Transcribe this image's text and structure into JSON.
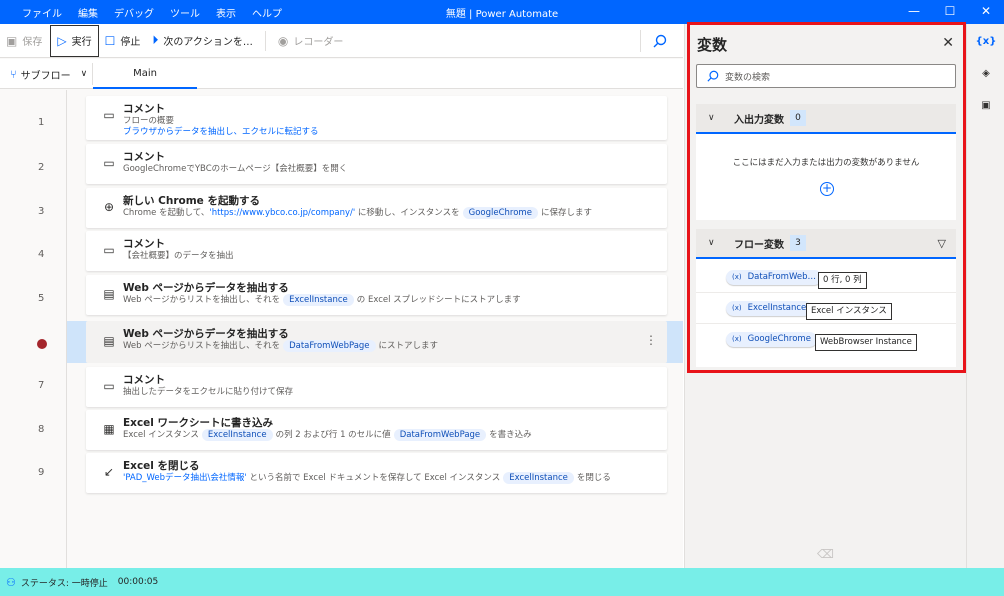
{
  "titlebar": {
    "menu": [
      "ファイル",
      "編集",
      "デバッグ",
      "ツール",
      "表示",
      "ヘルプ"
    ],
    "title": "無題 | Power Automate",
    "minimize": "—",
    "maximize": "☐",
    "close": "✕"
  },
  "toolbar": {
    "save": "保存",
    "run": "実行",
    "stop": "停止",
    "next": "次のアクションを…",
    "recorder": "レコーダー"
  },
  "tabs": {
    "subflow": "サブフロー",
    "main": "Main"
  },
  "steps": [
    {
      "line": "1",
      "title": "コメント",
      "desc": "フローの概要",
      "desc2": "ブラウザからデータを抽出し、エクセルに転記する"
    },
    {
      "line": "2",
      "title": "コメント",
      "desc": "GoogleChromeでYBCのホームページ【会社概要】を開く"
    },
    {
      "line": "3",
      "title": "新しい Chrome を起動する",
      "desc_a": "Chrome を起動して、",
      "desc_url": "'https://www.ybco.co.jp/company/'",
      "desc_b": " に移動し、インスタンスを",
      "desc_var": "GoogleChrome",
      "desc_c": "に保存します"
    },
    {
      "line": "4",
      "title": "コメント",
      "desc": "【会社概要】のデータを抽出"
    },
    {
      "line": "5",
      "title": "Web ページからデータを抽出する",
      "desc_a": "Web ページからリストを抽出し、それを",
      "desc_var": "ExcelInstance",
      "desc_b": "の Excel スプレッドシートにストアします"
    },
    {
      "line": "6",
      "title": "Web ページからデータを抽出する",
      "desc_a": "Web ページからリストを抽出し、それを",
      "desc_var": "DataFromWebPage",
      "desc_b": "にストアします"
    },
    {
      "line": "7",
      "title": "コメント",
      "desc": "抽出したデータをエクセルに貼り付けて保存"
    },
    {
      "line": "8",
      "title": "Excel ワークシートに書き込み",
      "desc_a": "Excel インスタンス",
      "desc_var": "ExcelInstance",
      "desc_b": "の列 2 および行 1 のセルに値",
      "desc_var2": "DataFromWebPage",
      "desc_c": "を書き込み"
    },
    {
      "line": "9",
      "title": "Excel を閉じる",
      "desc_url": "'PAD_Webデータ抽出\\会社情報'",
      "desc_a": " という名前で Excel ドキュメントを保存して Excel インスタンス",
      "desc_var": "ExcelInstance",
      "desc_b": "を閉じる"
    }
  ],
  "variables": {
    "title": "変数",
    "search_placeholder": "変数の検索",
    "io_section": {
      "title": "入出力変数",
      "count": "0",
      "empty": "ここにはまだ入力または出力の変数がありません"
    },
    "flow_section": {
      "title": "フロー変数",
      "count": "3"
    },
    "flow_vars": [
      {
        "name": "DataFromWeb…",
        "value": "0 行, 0 列"
      },
      {
        "name": "ExcelInstance",
        "value": "Excel インスタンス"
      },
      {
        "name": "GoogleChrome",
        "value": "WebBrowser Instance"
      }
    ]
  },
  "rail": {
    "vars": "{x}"
  },
  "status": {
    "label": "ステータス: 一時停止",
    "time": "00:00:05"
  }
}
